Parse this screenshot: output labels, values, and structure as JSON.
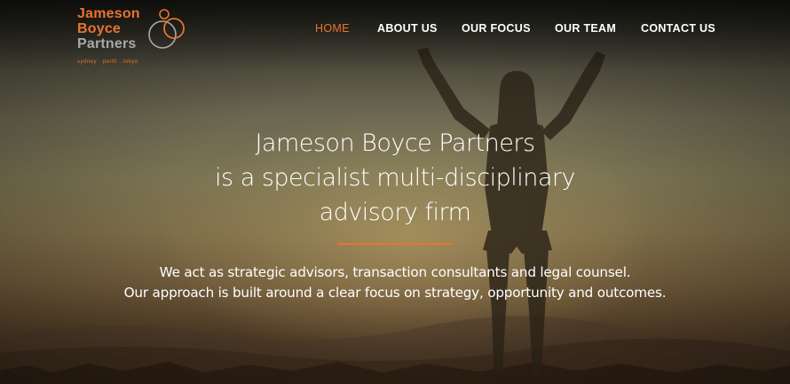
{
  "logo": {
    "line1": "Jameson",
    "line2": "Boyce",
    "line3": "Partners",
    "tagline": "sydney · perth · tokyo"
  },
  "nav": {
    "items": [
      {
        "label": "HOME",
        "active": true
      },
      {
        "label": "ABOUT US",
        "active": false
      },
      {
        "label": "OUR FOCUS",
        "active": false
      },
      {
        "label": "OUR TEAM",
        "active": false
      },
      {
        "label": "CONTACT US",
        "active": false
      }
    ]
  },
  "hero": {
    "headline_lines": [
      "Jameson Boyce Partners",
      "is a specialist multi-disciplinary",
      "advisory firm"
    ],
    "sub_lines": [
      "We act as strategic advisors, transaction consultants and legal counsel.",
      "Our approach is built around a clear focus on strategy, opportunity and outcomes."
    ]
  },
  "colors": {
    "accent": "#e8742f",
    "logo_grey": "#a9a9a9",
    "text": "#ffffff"
  }
}
